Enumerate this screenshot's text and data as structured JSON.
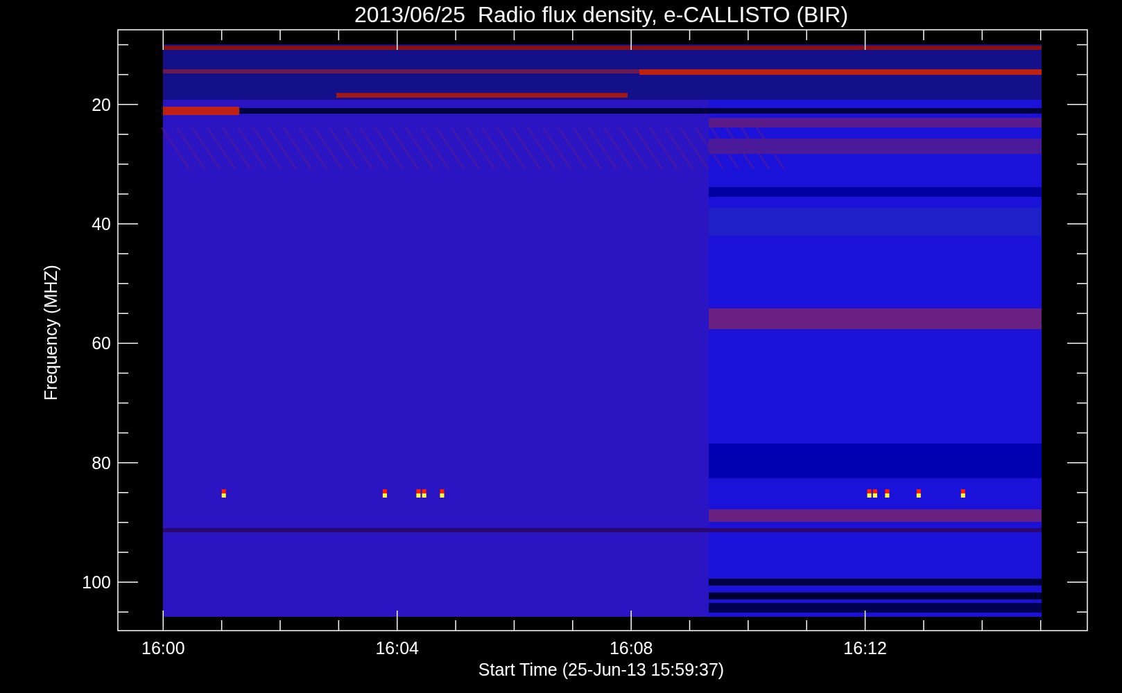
{
  "title": "2013/06/25  Radio flux density, e-CALLISTO (BIR)",
  "y_axis": {
    "label": "Frequency (MHZ)",
    "ticks": [
      "20",
      "40",
      "60",
      "80",
      "100"
    ]
  },
  "x_axis": {
    "label": "Start Time (25-Jun-13 15:59:37)",
    "ticks": [
      "16:00",
      "16:04",
      "16:08",
      "16:12"
    ]
  }
}
